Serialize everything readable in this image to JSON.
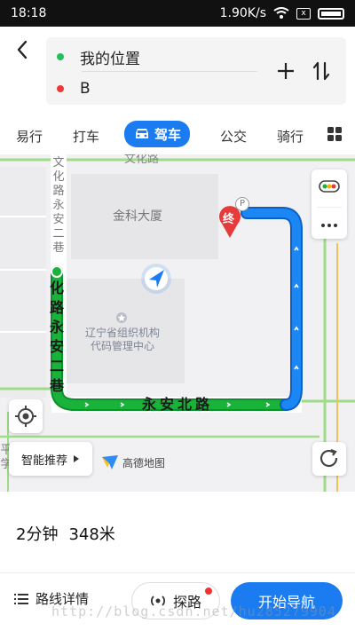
{
  "status_bar": {
    "time": "18:18",
    "speed": "1.90K/s"
  },
  "route": {
    "from": "我的位置",
    "to": "B"
  },
  "tabs": [
    {
      "label": "易行"
    },
    {
      "label": "打车"
    },
    {
      "label": "驾车",
      "active": true
    },
    {
      "label": "公交"
    },
    {
      "label": "骑行"
    }
  ],
  "map": {
    "building_label": "金科大厦",
    "poi_line1": "辽宁省组织机构",
    "poi_line2": "代码管理中心",
    "road_horizontal": "永安北路",
    "road_vertical": [
      "化",
      "路",
      "永",
      "安",
      "二",
      "巷"
    ],
    "road_faded_top": [
      "文",
      "化",
      "路",
      "永",
      "安",
      "二",
      "巷"
    ],
    "road_top": "文化路",
    "left_edge_chars": [
      "平",
      "学"
    ],
    "end_marker": "终",
    "parking_marker": "P",
    "brand": "高德地图",
    "smart_label": "智能推荐"
  },
  "summary": {
    "duration": "2分钟",
    "distance": "348米"
  },
  "bottom": {
    "details": "路线详情",
    "explore": "探路",
    "start": "开始导航"
  },
  "watermark": "http://blog.csdn.net/hu285279904",
  "colors": {
    "accent": "#1a7cf0",
    "route_green": "#19b33a",
    "route_blue": "#1a87f5"
  }
}
